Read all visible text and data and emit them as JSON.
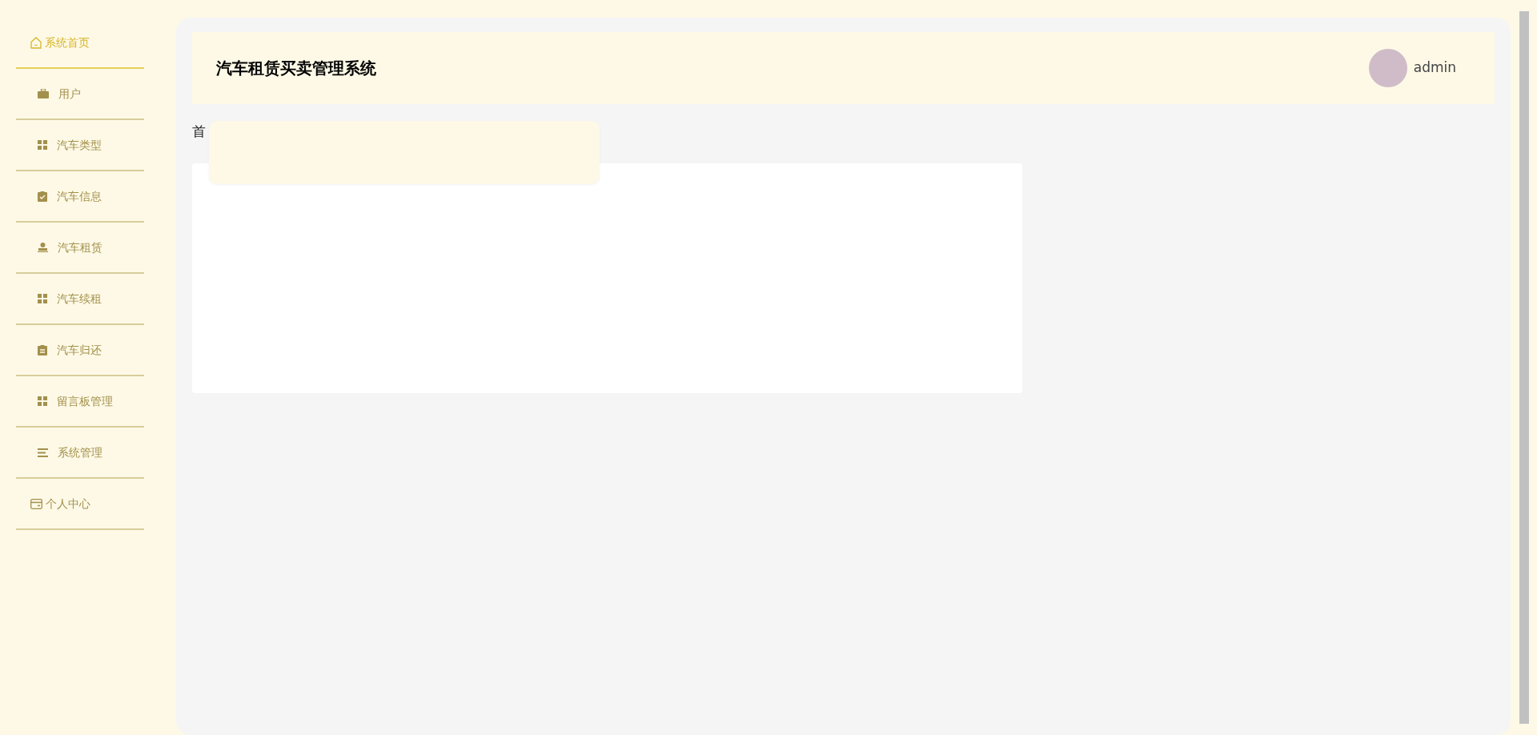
{
  "sidebar": {
    "items": [
      {
        "label": "系统首页",
        "kind": "link",
        "selected": true
      },
      {
        "label": "用户",
        "kind": "group",
        "selected": false
      },
      {
        "label": "汽车类型",
        "kind": "group",
        "selected": false
      },
      {
        "label": "汽车信息",
        "kind": "group",
        "selected": false
      },
      {
        "label": "汽车租赁",
        "kind": "group",
        "selected": false
      },
      {
        "label": "汽车续租",
        "kind": "group",
        "selected": false
      },
      {
        "label": "汽车归还",
        "kind": "group",
        "selected": false
      },
      {
        "label": "留言板管理",
        "kind": "group",
        "selected": false
      },
      {
        "label": "系统管理",
        "kind": "group",
        "selected": false
      },
      {
        "label": "个人中心",
        "kind": "link",
        "selected": false
      }
    ]
  },
  "header": {
    "title": "汽车租赁买卖管理系统",
    "user": "admin"
  },
  "breadcrumb": "首"
}
